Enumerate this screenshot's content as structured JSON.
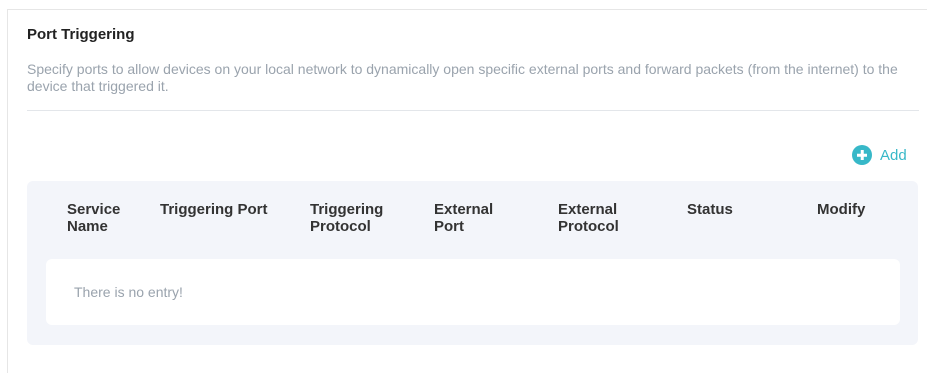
{
  "section": {
    "title": "Port Triggering",
    "description": "Specify ports to allow devices on your local network to dynamically open specific external ports and forward packets (from the internet) to the device that triggered it."
  },
  "toolbar": {
    "add_icon": "plus-circle-icon",
    "add_label": "Add"
  },
  "table": {
    "columns": [
      "Service Name",
      "Triggering Port",
      "Triggering Protocol",
      "External Port",
      "External Protocol",
      "Status",
      "Modify"
    ],
    "rows": [],
    "empty_message": "There is no entry!"
  },
  "colors": {
    "accent": "#37b8c8",
    "table_background": "#f3f5fa",
    "muted_text": "#9aa3ad"
  }
}
